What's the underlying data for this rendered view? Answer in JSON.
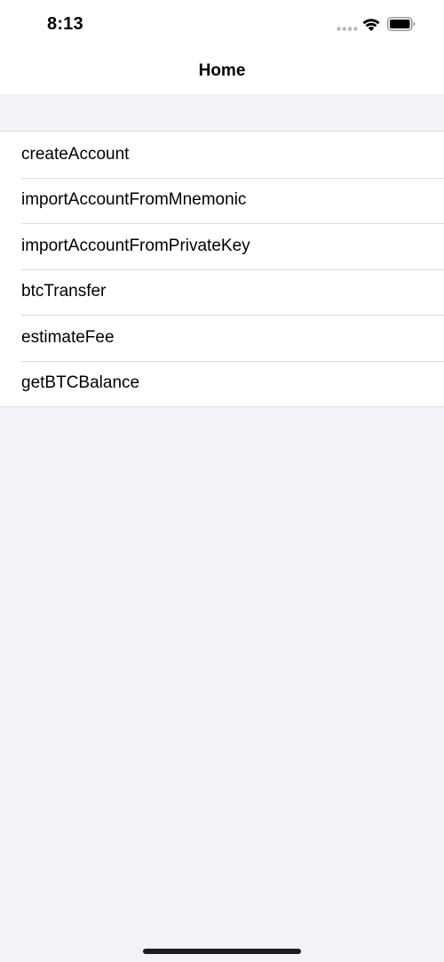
{
  "status_bar": {
    "time": "8:13",
    "icons": [
      "signal-dots-icon",
      "wifi-icon",
      "battery-icon"
    ]
  },
  "nav": {
    "title": "Home"
  },
  "menu": {
    "items": [
      {
        "label": "createAccount"
      },
      {
        "label": "importAccountFromMnemonic"
      },
      {
        "label": "importAccountFromPrivateKey"
      },
      {
        "label": "btcTransfer"
      },
      {
        "label": "estimateFee"
      },
      {
        "label": "getBTCBalance"
      }
    ]
  },
  "colors": {
    "background": "#f2f2f7",
    "surface": "#ffffff",
    "separator": "#dcdce0",
    "text": "#000000"
  }
}
